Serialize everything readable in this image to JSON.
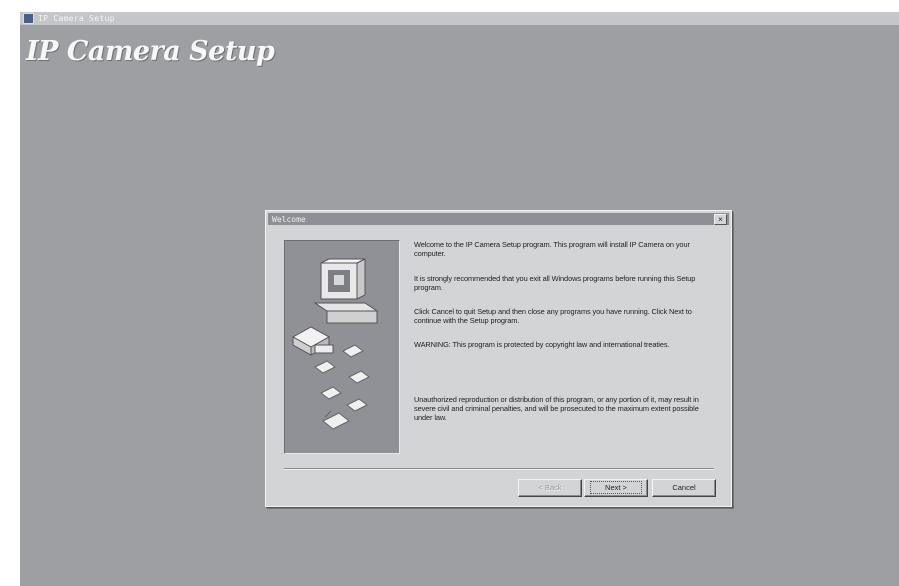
{
  "window": {
    "title": "IP Camera Setup"
  },
  "hero": {
    "title": "IP Camera Setup"
  },
  "dialog": {
    "title": "Welcome",
    "close_label": "×",
    "paragraphs": [
      "Welcome to the IP Camera Setup program. This program will install IP Camera on your computer.",
      "It is strongly recommended that you exit all Windows programs before running this Setup program.",
      "Click Cancel to quit Setup and then close any programs you have running. Click Next to continue with the Setup program.",
      "WARNING: This program is protected by copyright law and international treaties.",
      "Unauthorized reproduction or distribution of this program, or any portion of it, may result in severe civil and criminal penalties, and will be prosecuted to the maximum extent possible under law."
    ],
    "buttons": {
      "back": "< Back",
      "next": "Next >",
      "cancel": "Cancel"
    }
  }
}
